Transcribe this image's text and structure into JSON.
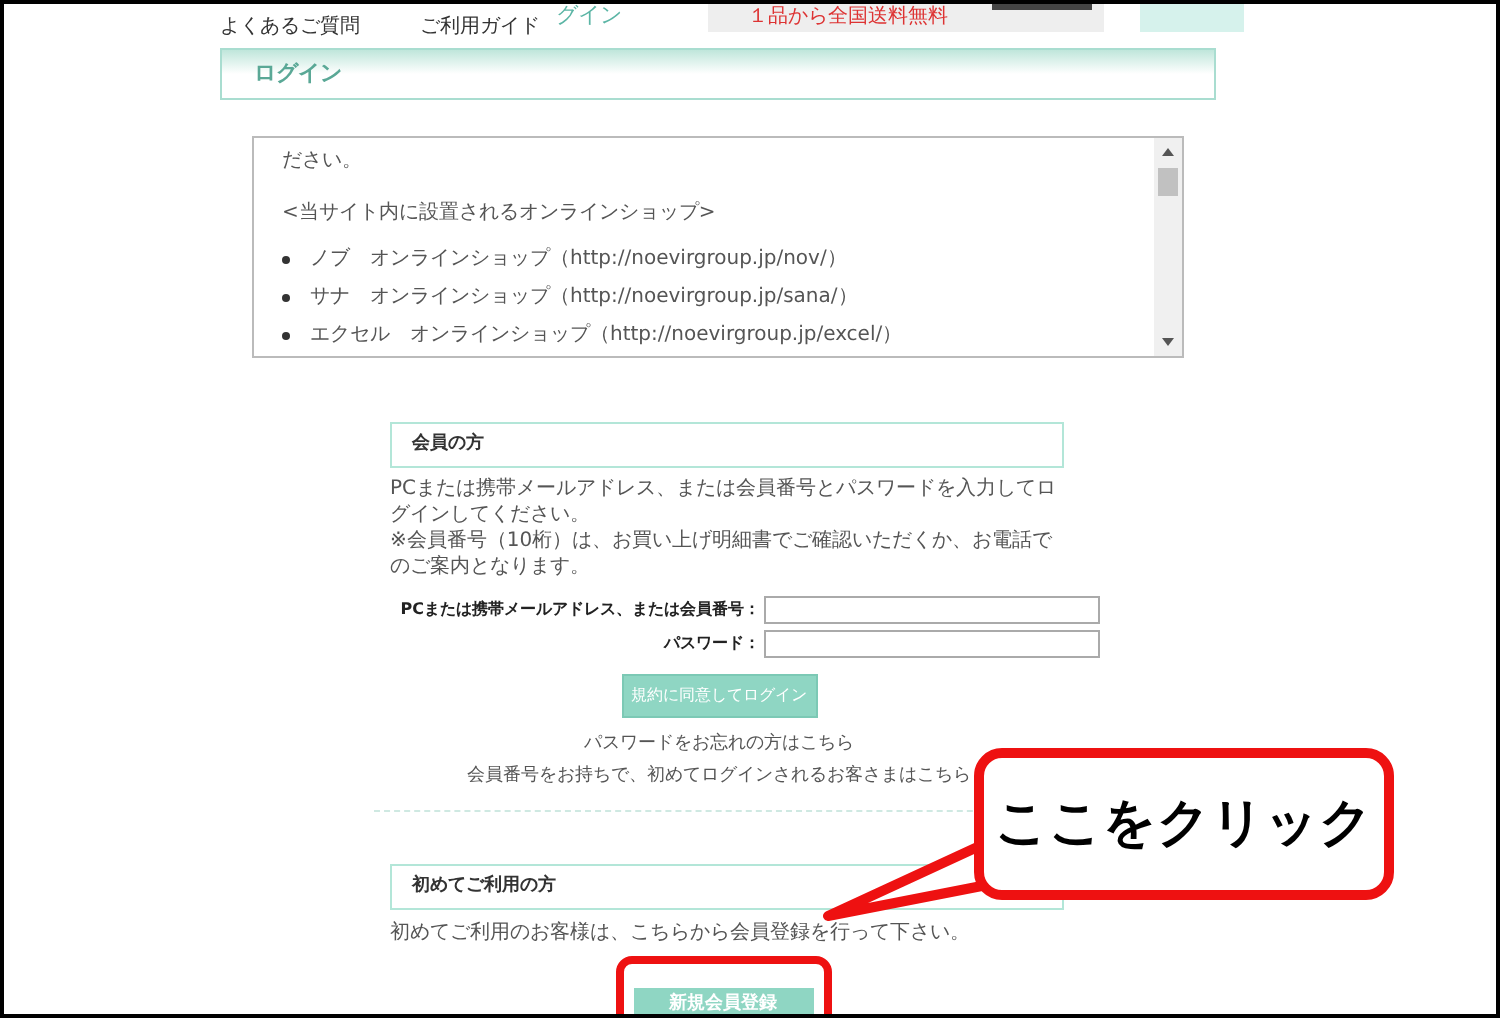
{
  "top_nav": {
    "items": [
      "よくあるご質問",
      "ご利用ガイド"
    ],
    "cut_title": "グイン",
    "promo": "１品から全国送料無料"
  },
  "login_header": "ログイン",
  "terms_box": {
    "lines": [
      {
        "kind": "text",
        "text": "ださい。"
      },
      {
        "kind": "heading",
        "text": "<当サイト内に設置されるオンラインショップ>"
      },
      {
        "kind": "bullet",
        "text": "ノブ　オンラインショップ（http://noevirgroup.jp/nov/）"
      },
      {
        "kind": "bullet",
        "text": "サナ　オンラインショップ（http://noevirgroup.jp/sana/）"
      },
      {
        "kind": "bullet",
        "text": "エクセル　オンラインショップ（http://noevirgroup.jp/excel/）"
      }
    ]
  },
  "member": {
    "title": "会員の方",
    "intro": [
      "PCまたは携帯メールアドレス、または会員番号とパスワードを入力してログインしてください。",
      "※会員番号（10桁）は、お買い上げ明細書でご確認いただくか、お電話でのご案内となります。"
    ],
    "fields": [
      {
        "label": "PCまたは携帯メールアドレス、または会員番号："
      },
      {
        "label": "パスワード："
      }
    ],
    "login_button": "規約に同意してログイン",
    "links": [
      "パスワードをお忘れの方はこちら",
      "会員番号をお持ちで、初めてログインされるお客さまはこちら"
    ]
  },
  "new_user": {
    "title": "初めてご利用の方",
    "text": "初めてご利用のお客様は、こちらから会員登録を行って下さい。",
    "register_button": "新規会員登録",
    "highlighted": true
  },
  "callout": "ここをクリック"
}
